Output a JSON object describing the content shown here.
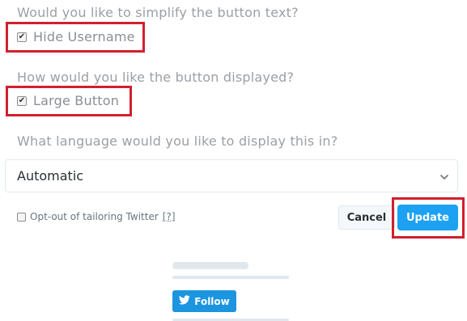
{
  "q_simplify": "Would you like to simplify the button text?",
  "hide_username": {
    "label": "Hide Username",
    "checked": true
  },
  "q_display": "How would you like the button displayed?",
  "large_button": {
    "label": "Large Button",
    "checked": true
  },
  "q_language": "What language would you like to display this in?",
  "language_select": {
    "value": "Automatic"
  },
  "optout": {
    "label": "Opt-out of tailoring Twitter",
    "help": "[?]",
    "checked": false
  },
  "buttons": {
    "cancel": "Cancel",
    "update": "Update"
  },
  "preview": {
    "follow_label": "Follow"
  },
  "colors": {
    "highlight": "#d0202e",
    "primary": "#1da1f2",
    "follow": "#1b95e0",
    "muted_text": "#9aa0a6"
  }
}
